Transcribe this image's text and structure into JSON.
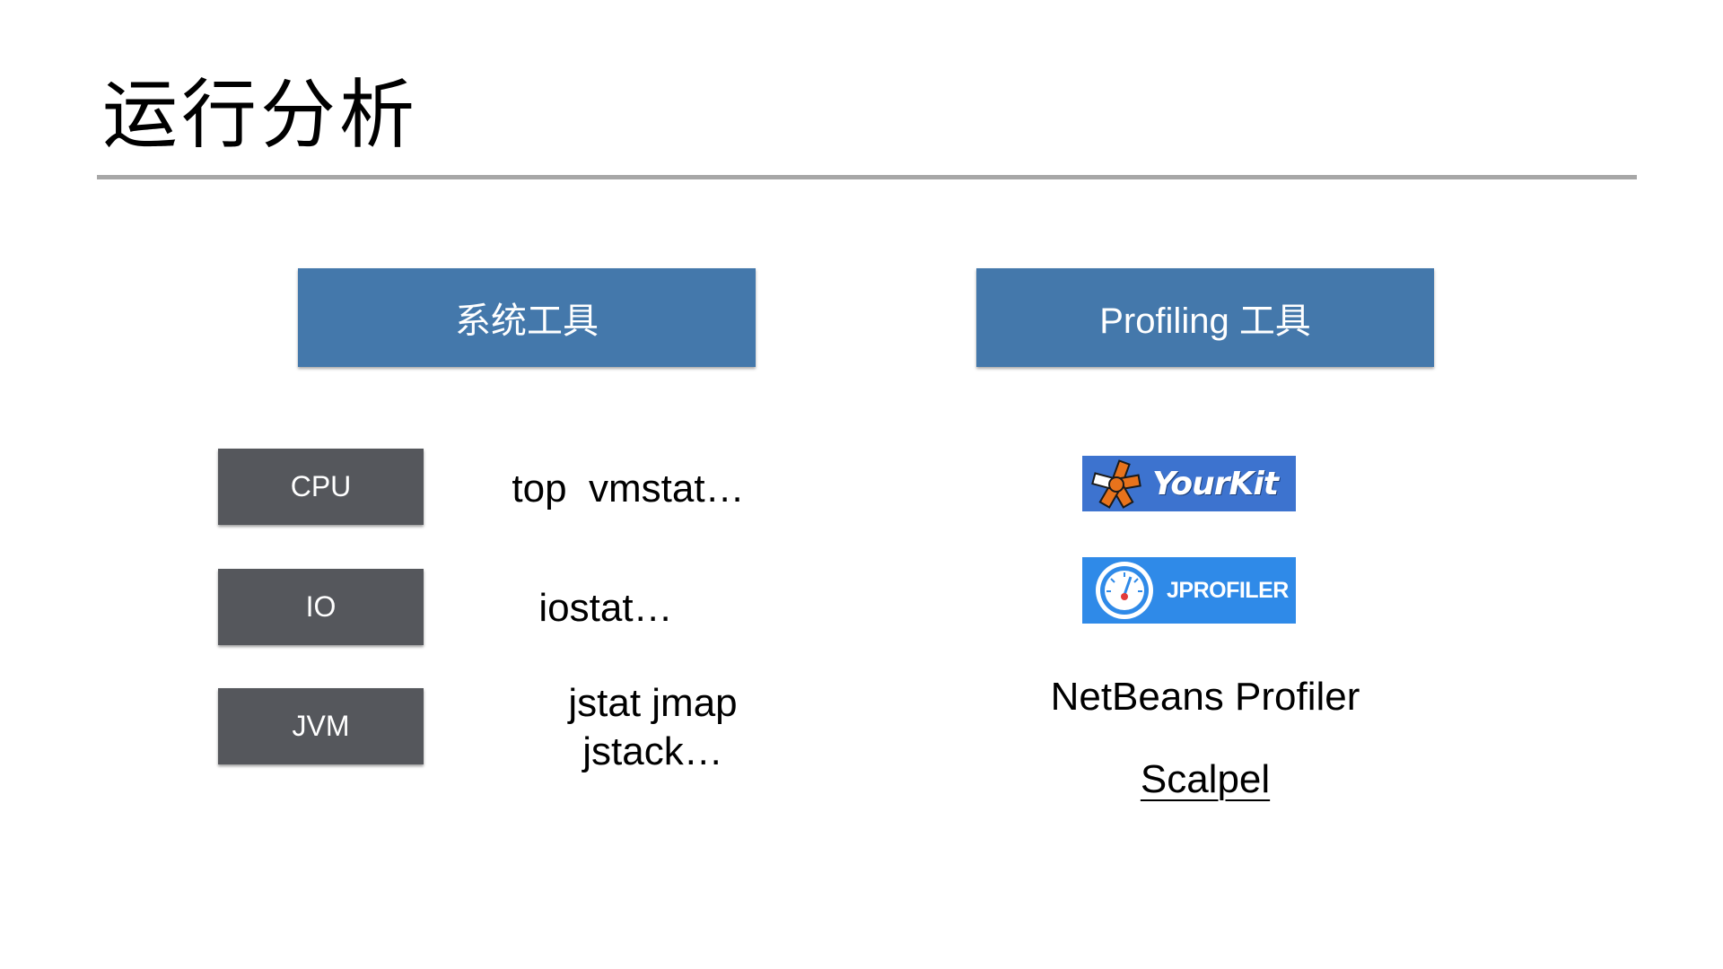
{
  "slide": {
    "title": "运行分析"
  },
  "headers": {
    "system_tools": "系统工具",
    "profiling_tools": "Profiling 工具"
  },
  "categories": [
    {
      "label": "CPU",
      "tools": "top  vmstat…"
    },
    {
      "label": "IO",
      "tools": "iostat…"
    },
    {
      "label": "JVM",
      "tools": "jstat jmap\njstack…"
    }
  ],
  "profilers": {
    "yourkit": "YourKit",
    "jprofiler": "JPROFILER",
    "netbeans": "NetBeans Profiler",
    "scalpel": "Scalpel"
  },
  "colors": {
    "header_blue": "#4478ab",
    "category_gray": "#55575c",
    "rule_gray": "#a7a7a7",
    "yourkit_blue": "#3d73cf",
    "yourkit_orange": "#e8731c",
    "jprofiler_blue": "#2f8ae8"
  },
  "icons": {
    "yourkit": "yourkit-logo-icon",
    "jprofiler": "jprofiler-gauge-icon"
  }
}
